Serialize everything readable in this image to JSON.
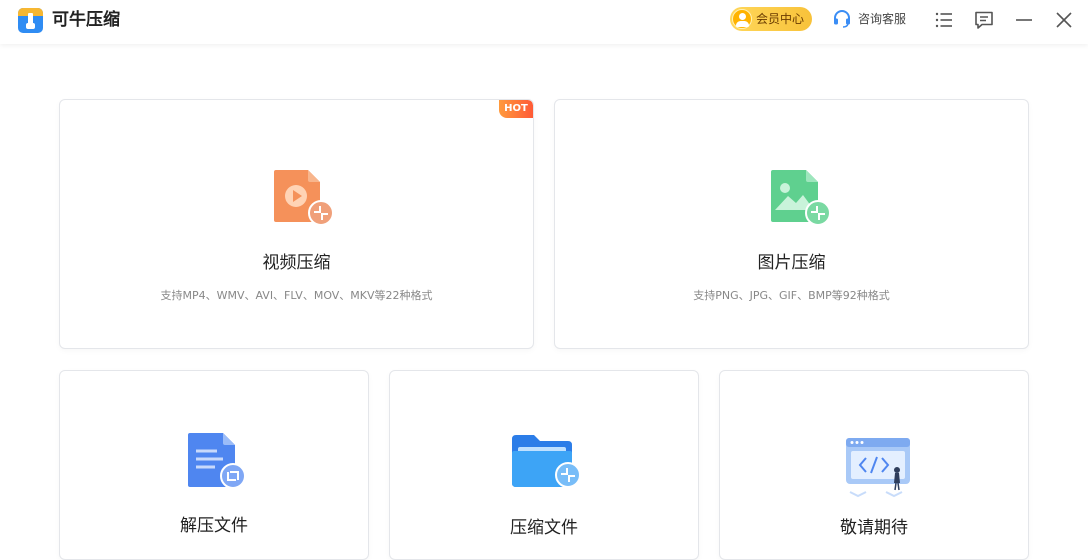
{
  "app": {
    "title": "可牛压缩"
  },
  "header": {
    "vip_label": "会员中心",
    "service_label": "咨询客服",
    "icons": [
      "menu-list-icon",
      "feedback-icon",
      "minimize-icon",
      "close-icon"
    ]
  },
  "cards": {
    "video": {
      "title": "视频压缩",
      "desc": "支持MP4、WMV、AVI、FLV、MOV、MKV等22种格式",
      "badge": "HOT"
    },
    "image": {
      "title": "图片压缩",
      "desc": "支持PNG、JPG、GIF、BMP等92种格式"
    },
    "extract": {
      "title": "解压文件"
    },
    "compress": {
      "title": "压缩文件"
    },
    "coming": {
      "title": "敬请期待"
    }
  },
  "colors": {
    "accent_vip": "#f8c23a",
    "video_icon": "#f5915a",
    "image_icon": "#5fd08f",
    "extract_icon": "#4f86f0",
    "compress_icon": "#3a98f5",
    "hot_badge": "#ff6a3a"
  }
}
